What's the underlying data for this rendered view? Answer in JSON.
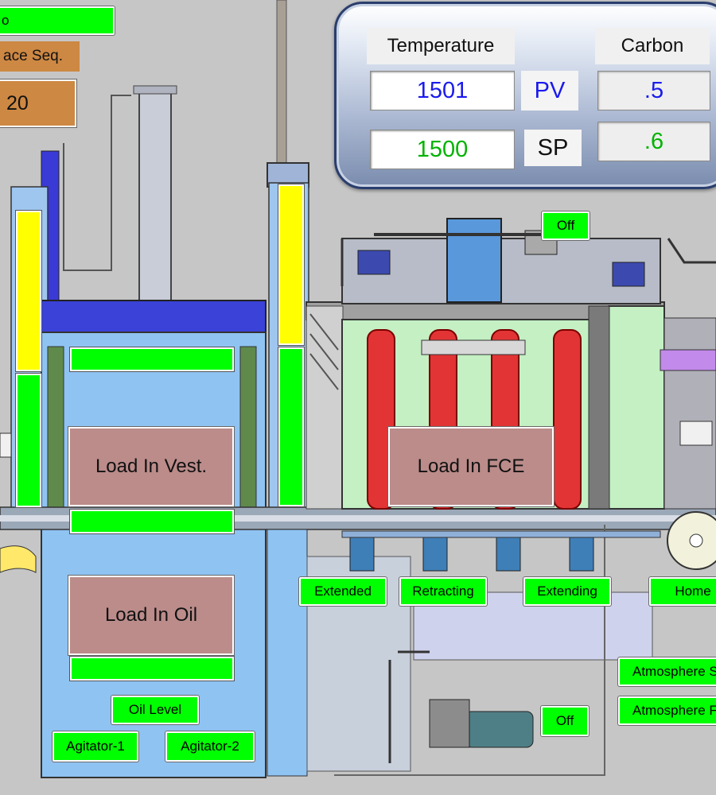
{
  "colors": {
    "status_on": "#00ff00",
    "status_warn": "#ffff00",
    "load_box": "#bb8c8a",
    "pv_text": "#1a1aee",
    "sp_text": "#00b300"
  },
  "header": {
    "top_button": "o",
    "sequence_label": "ace Seq.",
    "sequence_value": "20"
  },
  "panel": {
    "temperature_header": "Temperature",
    "carbon_header": "Carbon",
    "temperature_pv": "1501",
    "temperature_sp": "1500",
    "carbon_pv": ".5",
    "carbon_sp": ".6",
    "pv_label": "PV",
    "sp_label": "SP"
  },
  "status": {
    "top_off": "Off",
    "bottom_off": "Off",
    "oil_level": "Oil Level",
    "agitator_1": "Agitator-1",
    "agitator_2": "Agitator-2",
    "extended": "Extended",
    "retracting": "Retracting",
    "extending": "Extending",
    "home": "Home",
    "atmosphere_1": "Atmosphere S",
    "atmosphere_2": "Atmosphere F"
  },
  "loads": {
    "vestibule": "Load In Vest.",
    "oil": "Load In Oil",
    "furnace": "Load In FCE"
  }
}
